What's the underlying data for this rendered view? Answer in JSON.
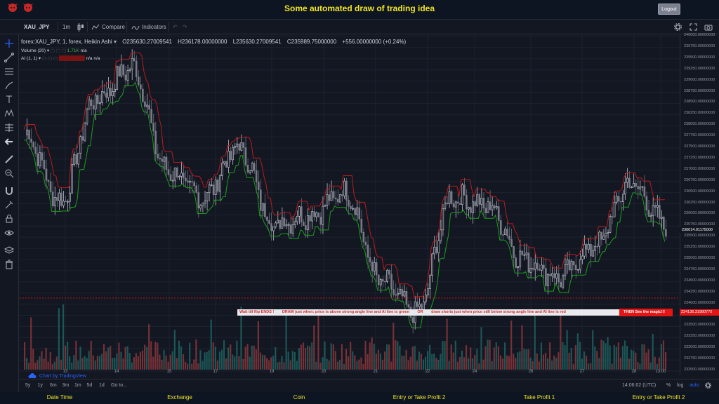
{
  "header": {
    "title": "Some automated draw of trading idea",
    "logout_label": "Logout",
    "logo_icon": "bull-icon",
    "accent_color": "#f2e61f"
  },
  "toolbar": {
    "symbol": "XAU_JPY",
    "interval": "1m",
    "compare_label": "Compare",
    "indicators_label": "Indicators"
  },
  "legend": {
    "series_title": "forex:XAU_JPY, 1, forex, Heikin Ashi",
    "open": "O235630.27009541",
    "high": "H236178.00000000",
    "low": "L235630.27009541",
    "close": "C235989.75000000",
    "change": "+556.00000000 (+0.24%)",
    "volume_label": "Volume (20)",
    "volume_value": "1.71K",
    "volume_na": "n/a",
    "ai_label": "AI (1, 1)",
    "ai_na_1": "n/a",
    "ai_na_2": "n/a"
  },
  "annotation": {
    "part1": "Wait till flip ENDS !",
    "part2": "DRAW just when:  price is above strong angle line and AI line is green",
    "part3": "OR",
    "part4": "draw shorts just when price still below strong angle line and AI line is red",
    "magic": "THEN See the magic!!!",
    "price_tag": "234136.31980770"
  },
  "price_axis": {
    "labels": [
      "240000.00000000",
      "239750.00000000",
      "239500.00000000",
      "239250.00000000",
      "239000.00000000",
      "238750.00000000",
      "238500.00000000",
      "238250.00000000",
      "238000.00000000",
      "237750.00000000",
      "237500.00000000",
      "237250.00000000",
      "237000.00000000",
      "236750.00000000",
      "236500.00000000",
      "236250.00000000",
      "236000.00000000",
      "235750.00000000",
      "235500.00000000",
      "235250.00000000",
      "235000.00000000",
      "234750.00000000",
      "234500.00000000",
      "234250.00000000",
      "234000.00000000",
      "233750.00000000",
      "233500.00000000",
      "233250.00000000",
      "233000.00000000",
      "232750.00000000",
      "232500.00000000"
    ],
    "last_price": "236014.01175000"
  },
  "time_axis": {
    "labels": [
      "13",
      "14",
      "15",
      "17",
      "19",
      "20",
      "21",
      "22",
      "24",
      "26",
      "27",
      "28",
      "13:00"
    ]
  },
  "bottom_bar": {
    "ranges": [
      "5y",
      "1y",
      "6m",
      "3m",
      "1m",
      "5d",
      "1d"
    ],
    "goto_label": "Go to...",
    "clock": "14:06:02 (UTC)",
    "percent_label": "%",
    "log_label": "log",
    "auto_label": "auto"
  },
  "watermark": "Chart by TradingView",
  "footer": {
    "columns": [
      "Date Time",
      "Exchange",
      "Coin",
      "Entry or Take Profit 2",
      "Take Profit 1",
      "Entry or Take Profit 2"
    ]
  },
  "colors": {
    "up": "#d1d4dc",
    "down": "#787b86",
    "ai_red": "#b71c1c",
    "ai_green": "#1b9e1b",
    "vol_up": "#26a69a",
    "vol_down": "#ef5350"
  },
  "chart_data": {
    "type": "line",
    "title": "forex:XAU_JPY, 1, forex, Heikin Ashi",
    "xlabel": "",
    "ylabel": "",
    "x": [
      13,
      14,
      15,
      17,
      19,
      20,
      21,
      22,
      24,
      26,
      27,
      28,
      29
    ],
    "ylim": [
      232500,
      240000
    ],
    "series": [
      {
        "values": [
          237800,
          236300,
          238600,
          239300,
          237000,
          236400,
          237500,
          235800,
          236000,
          236500,
          234500,
          233800,
          236400,
          236200,
          235000,
          234600,
          235300,
          236700,
          235800
        ]
      }
    ]
  }
}
